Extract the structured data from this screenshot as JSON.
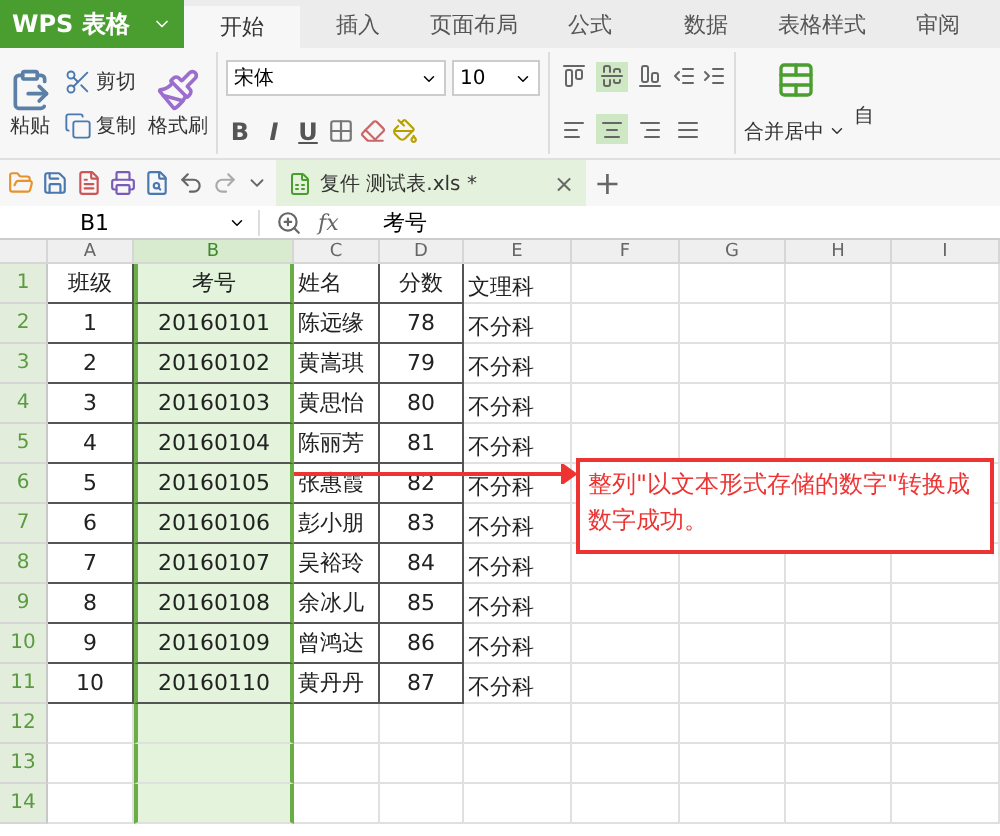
{
  "app": {
    "logo": "WPS 表格",
    "tabs": [
      {
        "label": "开始",
        "selected": true
      },
      {
        "label": "插入",
        "selected": false
      },
      {
        "label": "页面布局",
        "selected": false
      },
      {
        "label": "公式",
        "selected": false
      },
      {
        "label": "数据",
        "selected": false
      },
      {
        "label": "表格样式",
        "selected": false
      },
      {
        "label": "审阅",
        "selected": false
      }
    ]
  },
  "ribbon": {
    "paste": "粘贴",
    "cut": "剪切",
    "copy": "复制",
    "format_painter": "格式刷",
    "font_name": "宋体",
    "font_size": "10",
    "bold": "B",
    "italic": "I",
    "underline": "U",
    "align_top": [
      {
        "selected": false
      },
      {
        "selected": true
      },
      {
        "selected": false
      }
    ],
    "align_bottom": [
      {
        "selected": false
      },
      {
        "selected": true
      },
      {
        "selected": false
      },
      {
        "selected": false
      }
    ],
    "merge": "合并居中",
    "next_label": "自"
  },
  "doc_tab": {
    "label": "复件 测试表.xls *",
    "close": "×",
    "new": "+"
  },
  "formula_bar": {
    "cell_ref": "B1",
    "fx": "fx",
    "value": "考号"
  },
  "sheet": {
    "columns": [
      {
        "label": "A",
        "selected": false
      },
      {
        "label": "B",
        "selected": true
      },
      {
        "label": "C",
        "selected": false
      },
      {
        "label": "D",
        "selected": false
      },
      {
        "label": "E",
        "selected": false
      },
      {
        "label": "F",
        "selected": false
      },
      {
        "label": "G",
        "selected": false
      },
      {
        "label": "H",
        "selected": false
      },
      {
        "label": "I",
        "selected": false
      }
    ],
    "rows": [
      {
        "label": "1",
        "cells": [
          "班级",
          "考号",
          "姓名",
          "分数",
          "文理科"
        ]
      },
      {
        "label": "2",
        "cells": [
          "1",
          "20160101",
          "陈远缘",
          "78",
          "不分科"
        ]
      },
      {
        "label": "3",
        "cells": [
          "2",
          "20160102",
          "黄嵩琪",
          "79",
          "不分科"
        ]
      },
      {
        "label": "4",
        "cells": [
          "3",
          "20160103",
          "黄思怡",
          "80",
          "不分科"
        ]
      },
      {
        "label": "5",
        "cells": [
          "4",
          "20160104",
          "陈丽芳",
          "81",
          "不分科"
        ]
      },
      {
        "label": "6",
        "cells": [
          "5",
          "20160105",
          "张惠霞",
          "82",
          "不分科"
        ]
      },
      {
        "label": "7",
        "cells": [
          "6",
          "20160106",
          "彭小朋",
          "83",
          "不分科"
        ]
      },
      {
        "label": "8",
        "cells": [
          "7",
          "20160107",
          "吴裕玲",
          "84",
          "不分科"
        ]
      },
      {
        "label": "9",
        "cells": [
          "8",
          "20160108",
          "余冰儿",
          "85",
          "不分科"
        ]
      },
      {
        "label": "10",
        "cells": [
          "9",
          "20160109",
          "曾鸿达",
          "86",
          "不分科"
        ]
      },
      {
        "label": "11",
        "cells": [
          "10",
          "20160110",
          "黄丹丹",
          "87",
          "不分科"
        ]
      },
      {
        "label": "12",
        "cells": []
      },
      {
        "label": "13",
        "cells": []
      },
      {
        "label": "14",
        "cells": []
      }
    ],
    "annotation": "整列\"以文本形式存储的数字\"转换成数字成功。"
  }
}
